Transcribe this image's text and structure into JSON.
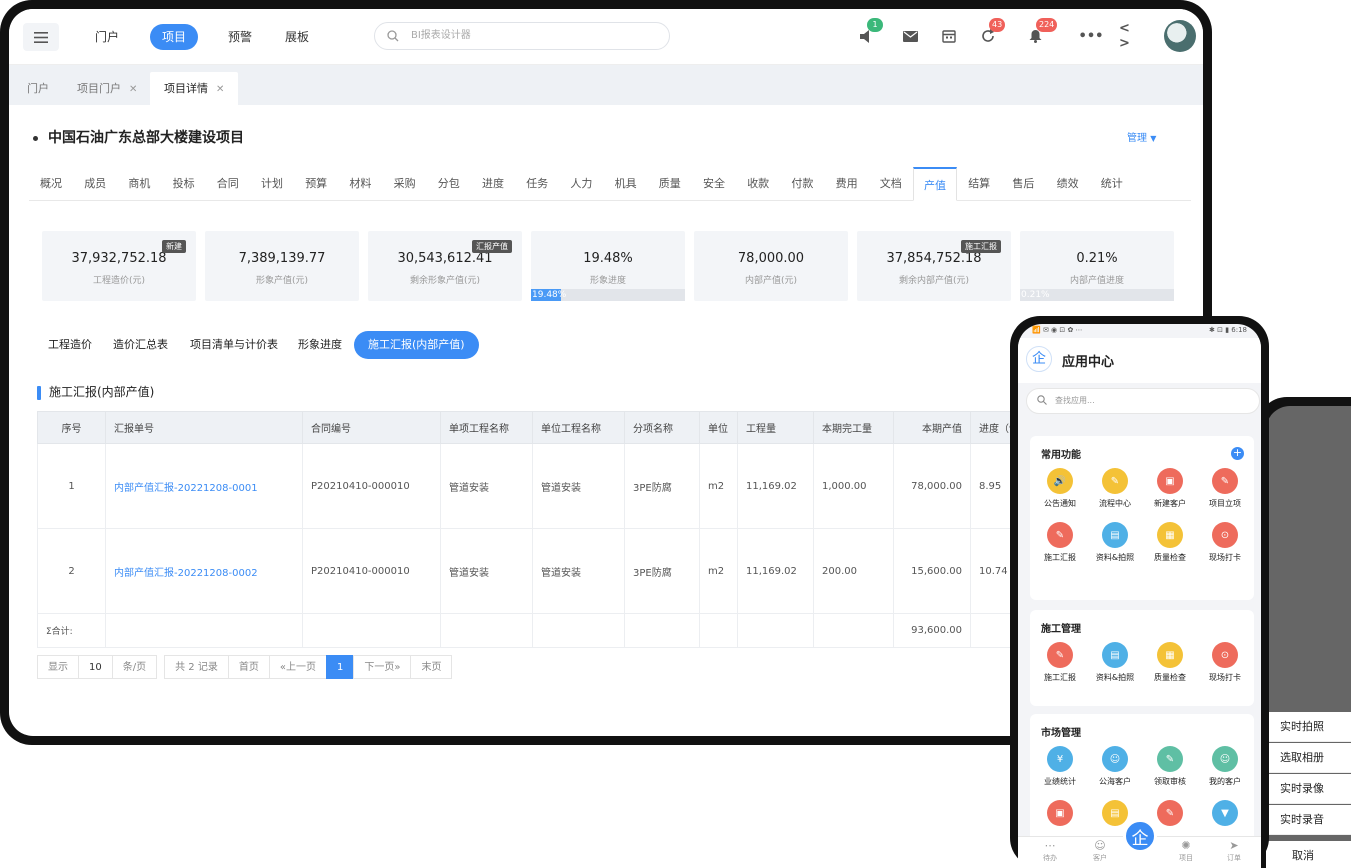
{
  "topbar": {
    "nav": [
      "门户",
      "项目",
      "预警",
      "展板"
    ],
    "search_placeholder": "BI报表设计器",
    "badges": {
      "speaker": "1",
      "refresh": "43",
      "bell": "224"
    },
    "code_icon": "< >"
  },
  "tabs": [
    {
      "label": "门户",
      "closable": false
    },
    {
      "label": "项目门户",
      "closable": true
    },
    {
      "label": "项目详情",
      "closable": true
    }
  ],
  "page": {
    "title": "中国石油广东总部大楼建设项目",
    "manage": "管理"
  },
  "main_tabs": [
    "概况",
    "成员",
    "商机",
    "投标",
    "合同",
    "计划",
    "预算",
    "材料",
    "采购",
    "分包",
    "进度",
    "任务",
    "人力",
    "机具",
    "质量",
    "安全",
    "收款",
    "付款",
    "费用",
    "文档",
    "产值",
    "结算",
    "售后",
    "绩效",
    "统计"
  ],
  "cards": [
    {
      "value": "37,932,752.18",
      "label": "工程造价(元)",
      "tag": "新建"
    },
    {
      "value": "7,389,139.77",
      "label": "形象产值(元)",
      "tag": ""
    },
    {
      "value": "30,543,612.41",
      "label": "剩余形象产值(元)",
      "tag": "汇报产值"
    },
    {
      "value": "19.48%",
      "label": "形象进度",
      "tag": "",
      "progress": 0.1948,
      "progress_label": "19.48%"
    },
    {
      "value": "78,000.00",
      "label": "内部产值(元)",
      "tag": ""
    },
    {
      "value": "37,854,752.18",
      "label": "剩余内部产值(元)",
      "tag": "施工汇报"
    },
    {
      "value": "0.21%",
      "label": "内部产值进度",
      "tag": "",
      "progress": 0.0021,
      "progress_label": "0.21%"
    }
  ],
  "sub_tabs": [
    "工程造价",
    "造价汇总表",
    "项目清单与计价表",
    "形象进度",
    "施工汇报(内部产值)"
  ],
  "section_title": "施工汇报(内部产值)",
  "table": {
    "headers": [
      "序号",
      "汇报单号",
      "合同编号",
      "单项工程名称",
      "单位工程名称",
      "分项名称",
      "单位",
      "工程量",
      "本期完工量",
      "本期产值",
      "进度（%"
    ],
    "rows": [
      [
        "1",
        "内部产值汇报-20221208-0001",
        "P20210410-000010",
        "管道安装",
        "管道安装",
        "3PE防腐",
        "m2",
        "11,169.02",
        "1,000.00",
        "78,000.00",
        "8.95"
      ],
      [
        "2",
        "内部产值汇报-20221208-0002",
        "P20210410-000010",
        "管道安装",
        "管道安装",
        "3PE防腐",
        "m2",
        "11,169.02",
        "200.00",
        "15,600.00",
        "10.74"
      ]
    ],
    "sum_label": "Σ合计:",
    "sum_value": "93,600.00"
  },
  "pager": {
    "show": "显示",
    "size": "10",
    "per": "条/页",
    "total": "共 2 记录",
    "first": "首页",
    "prev": "«上一页",
    "current": "1",
    "next": "下一页»",
    "last": "末页"
  },
  "sheet": {
    "items": [
      "实时拍照",
      "选取相册",
      "实时录像",
      "实时录音"
    ],
    "cancel": "取消"
  },
  "phone": {
    "status_left": "📶 ✉ ◉ ⊡ ✿ ⋯",
    "status_right": "✱ ⊡ ▮ 6:18",
    "logo": "企",
    "title": "应用中心",
    "search_placeholder": "查找应用...",
    "sections": [
      {
        "title": "常用功能",
        "apps": [
          {
            "label": "公告通知",
            "color": "#f4c237",
            "icon": "🔊"
          },
          {
            "label": "流程中心",
            "color": "#f4c237",
            "icon": "✎"
          },
          {
            "label": "新建客户",
            "color": "#ee6b5c",
            "icon": "▣"
          },
          {
            "label": "项目立项",
            "color": "#ee6b5c",
            "icon": "✎"
          },
          {
            "label": "施工汇报",
            "color": "#ee6b5c",
            "icon": "✎"
          },
          {
            "label": "资料&拍照",
            "color": "#4fb0e6",
            "icon": "▤"
          },
          {
            "label": "质量检查",
            "color": "#f4c237",
            "icon": "▦"
          },
          {
            "label": "现场打卡",
            "color": "#ee6b5c",
            "icon": "⊙"
          }
        ]
      },
      {
        "title": "施工管理",
        "apps": [
          {
            "label": "施工汇报",
            "color": "#ee6b5c",
            "icon": "✎"
          },
          {
            "label": "资料&拍照",
            "color": "#4fb0e6",
            "icon": "▤"
          },
          {
            "label": "质量检查",
            "color": "#f4c237",
            "icon": "▦"
          },
          {
            "label": "现场打卡",
            "color": "#ee6b5c",
            "icon": "⊙"
          }
        ]
      },
      {
        "title": "市场管理",
        "apps": [
          {
            "label": "业绩统计",
            "color": "#4fb0e6",
            "icon": "¥"
          },
          {
            "label": "公海客户",
            "color": "#4fb0e6",
            "icon": "☺"
          },
          {
            "label": "领取审核",
            "color": "#5fbfa4",
            "icon": "✎"
          },
          {
            "label": "我的客户",
            "color": "#5fbfa4",
            "icon": "☺"
          },
          {
            "label": "",
            "color": "#ee6b5c",
            "icon": "▣"
          },
          {
            "label": "",
            "color": "#f4c237",
            "icon": "▤"
          },
          {
            "label": "",
            "color": "#ee6b5c",
            "icon": "✎"
          },
          {
            "label": "",
            "color": "#4fb0e6",
            "icon": "▼"
          }
        ]
      }
    ],
    "bottom_nav": [
      {
        "label": "待办",
        "icon": "⋯"
      },
      {
        "label": "客户",
        "icon": "☺"
      },
      {
        "label": "项目",
        "icon": "✺"
      },
      {
        "label": "订单",
        "icon": "➤"
      }
    ],
    "fab": "企"
  }
}
